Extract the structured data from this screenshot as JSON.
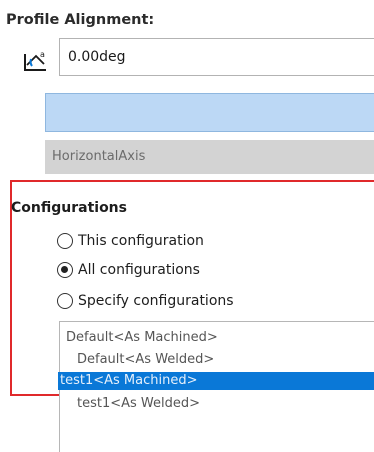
{
  "profile_alignment": {
    "title": "Profile Alignment:",
    "angle_value": "0.00deg",
    "axis_value": "HorizontalAxis"
  },
  "configurations": {
    "title": "Configurations",
    "options": [
      {
        "label": "This configuration",
        "selected": false
      },
      {
        "label": "All configurations",
        "selected": true
      },
      {
        "label": "Specify configurations",
        "selected": false
      }
    ],
    "list": [
      {
        "label": "Default<As Machined>",
        "selected": false
      },
      {
        "label": "Default<As Welded>",
        "selected": false
      },
      {
        "label": "test1<As Machined>",
        "selected": true
      },
      {
        "label": "test1<As Welded>",
        "selected": false
      }
    ]
  },
  "colors": {
    "highlight_border": "#e0292b",
    "selection_fill": "#bcd8f5",
    "list_selected": "#0a78d7"
  },
  "icons": {
    "angle": "angle-icon"
  }
}
